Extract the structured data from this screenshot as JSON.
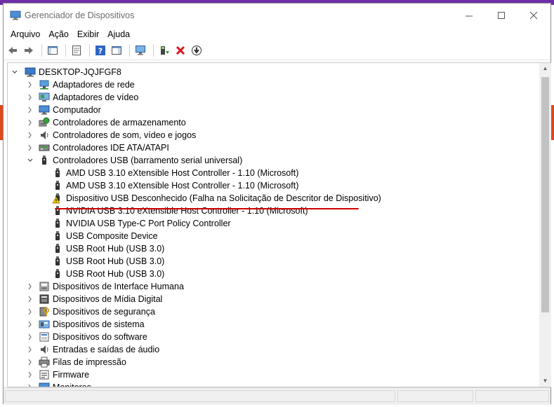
{
  "window": {
    "title": "Gerenciador de Dispositivos"
  },
  "menu": [
    "Arquivo",
    "Ação",
    "Exibir",
    "Ajuda"
  ],
  "toolbar": [
    {
      "name": "back-icon"
    },
    {
      "name": "forward-icon"
    },
    {
      "sep": true
    },
    {
      "name": "show-hide-console-tree-icon"
    },
    {
      "sep": true
    },
    {
      "name": "properties-icon"
    },
    {
      "sep": true
    },
    {
      "name": "help-icon"
    },
    {
      "name": "action-pane-icon"
    },
    {
      "sep": true
    },
    {
      "name": "scan-hardware-icon"
    },
    {
      "sep": true
    },
    {
      "name": "update-driver-icon"
    },
    {
      "name": "uninstall-device-icon"
    },
    {
      "name": "disable-device-icon"
    }
  ],
  "tree": [
    {
      "level": 0,
      "arrow": "down",
      "icon": "computer",
      "label": "DESKTOP-JQJFGF8"
    },
    {
      "level": 1,
      "arrow": "right",
      "icon": "network",
      "label": "Adaptadores de rede"
    },
    {
      "level": 1,
      "arrow": "right",
      "icon": "display",
      "label": "Adaptadores de vídeo"
    },
    {
      "level": 1,
      "arrow": "right",
      "icon": "monitor",
      "label": "Computador"
    },
    {
      "level": 1,
      "arrow": "right",
      "icon": "storage",
      "label": "Controladores de armazenamento"
    },
    {
      "level": 1,
      "arrow": "right",
      "icon": "speaker",
      "label": "Controladores de som, vídeo e jogos"
    },
    {
      "level": 1,
      "arrow": "right",
      "icon": "ide",
      "label": "Controladores IDE ATA/ATAPI"
    },
    {
      "level": 1,
      "arrow": "down",
      "icon": "usb",
      "label": "Controladores USB (barramento serial universal)"
    },
    {
      "level": 2,
      "icon": "usb",
      "label": "AMD USB 3.10 eXtensible Host Controller - 1.10 (Microsoft)"
    },
    {
      "level": 2,
      "icon": "usb",
      "label": "AMD USB 3.10 eXtensible Host Controller - 1.10 (Microsoft)"
    },
    {
      "level": 2,
      "icon": "usb-warning",
      "label": "Dispositivo USB Desconhecido (Falha na Solicitação de Descritor de Dispositivo)"
    },
    {
      "level": 2,
      "icon": "usb",
      "label": "NVIDIA USB 3.10 eXtensible Host Controller - 1.10 (Microsoft)"
    },
    {
      "level": 2,
      "icon": "usb",
      "label": "NVIDIA USB Type-C Port Policy Controller"
    },
    {
      "level": 2,
      "icon": "usb",
      "label": "USB Composite Device"
    },
    {
      "level": 2,
      "icon": "usb",
      "label": "USB Root Hub (USB 3.0)"
    },
    {
      "level": 2,
      "icon": "usb",
      "label": "USB Root Hub (USB 3.0)"
    },
    {
      "level": 2,
      "icon": "usb",
      "label": "USB Root Hub (USB 3.0)"
    },
    {
      "level": 1,
      "arrow": "right",
      "icon": "hid",
      "label": "Dispositivos de Interface Humana"
    },
    {
      "level": 1,
      "arrow": "right",
      "icon": "media",
      "label": "Dispositivos de Mídia Digital"
    },
    {
      "level": 1,
      "arrow": "right",
      "icon": "security",
      "label": "Dispositivos de segurança"
    },
    {
      "level": 1,
      "arrow": "right",
      "icon": "system",
      "label": "Dispositivos de sistema"
    },
    {
      "level": 1,
      "arrow": "right",
      "icon": "software",
      "label": "Dispositivos do software"
    },
    {
      "level": 1,
      "arrow": "right",
      "icon": "audio",
      "label": "Entradas e saídas de áudio"
    },
    {
      "level": 1,
      "arrow": "right",
      "icon": "printer",
      "label": "Filas de impressão"
    },
    {
      "level": 1,
      "arrow": "right",
      "icon": "firmware",
      "label": "Firmware"
    },
    {
      "level": 1,
      "arrow": "right",
      "icon": "monitor",
      "label": "Monitores"
    }
  ],
  "colors": {
    "warning": "#f5c400",
    "annotation": "#d10000",
    "scroll_thumb": "#c2c2c2"
  }
}
